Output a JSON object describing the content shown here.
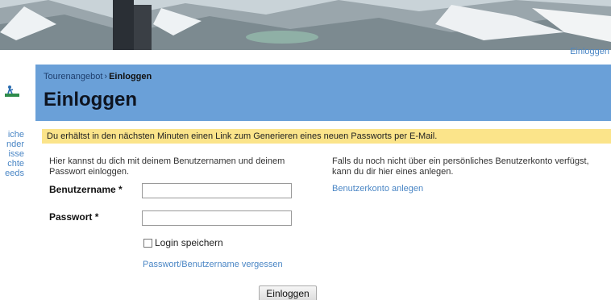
{
  "top": {
    "login_link": "Einloggen"
  },
  "sidebar": {
    "logo_icon": "hiker-logo-icon",
    "fragments": [
      "iche",
      "nder",
      "isse",
      "chte",
      "eeds"
    ]
  },
  "header": {
    "breadcrumb": {
      "parent": "Tourenangebot",
      "separator": "›",
      "current": "Einloggen"
    },
    "title": "Einloggen"
  },
  "notice": {
    "text": "Du erhältst in den nächsten Minuten einen Link zum Generieren eines neuen Passworts per E-Mail."
  },
  "login_form": {
    "intro": "Hier kannst du dich mit deinem Benutzernamen und deinem Passwort einloggen.",
    "username_label": "Benutzername *",
    "username_value": "",
    "password_label": "Passwort *",
    "password_value": "",
    "remember_label": "Login speichern",
    "remember_checked": false,
    "forgot_link": "Passwort/Benutzername vergessen",
    "submit_label": "Einloggen"
  },
  "register": {
    "info": "Falls du noch nicht über ein persönliches Benutzerkonto verfügst, kann du dir hier eines anlegen.",
    "create_link": "Benutzerkonto anlegen"
  },
  "colors": {
    "header_bg": "#6aa0d8",
    "notice_bg": "#fbe48a",
    "link": "#4a86c5"
  }
}
